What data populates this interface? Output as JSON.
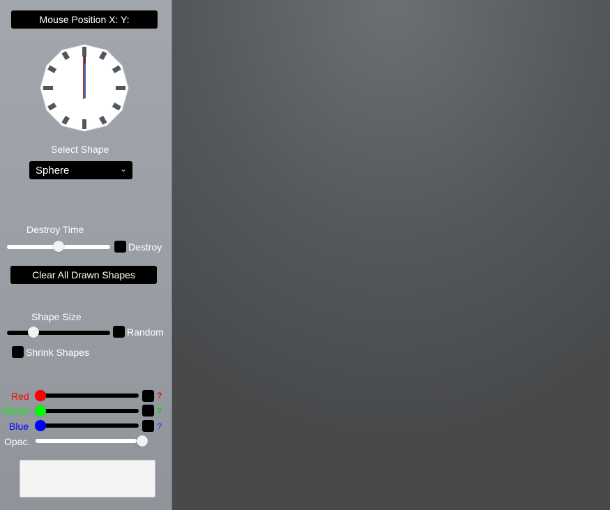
{
  "panel": {
    "mouse_position_label": "Mouse Position X:  Y:",
    "select_shape_label": "Select Shape",
    "shape_dropdown": {
      "selected": "Sphere"
    },
    "destroy_time_label": "Destroy Time",
    "destroy_time_value": 0.5,
    "destroy_checkbox_label": "Destroy",
    "clear_button_label": "Clear All Drawn Shapes",
    "shape_size_label": "Shape Size",
    "shape_size_value": 0.23,
    "random_checkbox_label": "Random",
    "shrink_checkbox_label": "Shrink Shapes",
    "colors": {
      "red_label": "Red",
      "green_label": "Green",
      "blue_label": "Blue",
      "opacity_label": "Opac.",
      "question_mark": "?",
      "red_value": 0,
      "green_value": 0,
      "blue_value": 0,
      "opacity_value": 1,
      "red_hex": "#ff0000",
      "green_hex": "#00ff00",
      "blue_hex": "#0000ff"
    }
  },
  "clock": {
    "hour": 12,
    "minute": 0
  }
}
